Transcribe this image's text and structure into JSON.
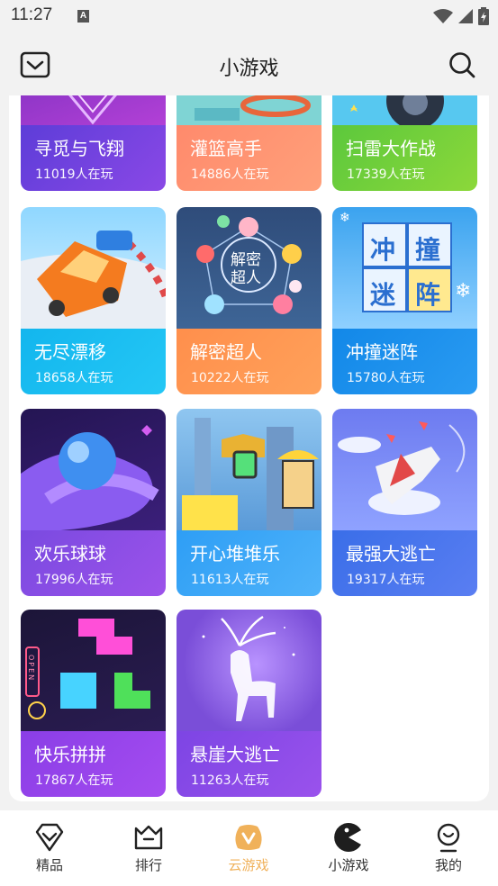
{
  "status_bar": {
    "time": "11:27",
    "notification_badge": "A"
  },
  "header": {
    "title": "小游戏"
  },
  "games": [
    {
      "name": "寻觅与飞翔",
      "players": "11019人在玩"
    },
    {
      "name": "灌篮高手",
      "players": "14886人在玩"
    },
    {
      "name": "扫雷大作战",
      "players": "17339人在玩"
    },
    {
      "name": "无尽漂移",
      "players": "18658人在玩"
    },
    {
      "name": "解密超人",
      "players": "10222人在玩",
      "art_text": [
        "解密",
        "超人"
      ]
    },
    {
      "name": "冲撞迷阵",
      "players": "15780人在玩",
      "art_text": [
        "冲",
        "撞",
        "迷",
        "阵"
      ]
    },
    {
      "name": "欢乐球球",
      "players": "17996人在玩"
    },
    {
      "name": "开心堆堆乐",
      "players": "11613人在玩"
    },
    {
      "name": "最强大逃亡",
      "players": "19317人在玩"
    },
    {
      "name": "快乐拼拼",
      "players": "17867人在玩",
      "art_text": "OPEN"
    },
    {
      "name": "悬崖大逃亡",
      "players": "11263人在玩"
    }
  ],
  "bottom_nav": [
    {
      "label": "精品",
      "icon": "diamond-icon"
    },
    {
      "label": "排行",
      "icon": "crown-icon"
    },
    {
      "label": "云游戏",
      "icon": "gamepad-icon",
      "active": true
    },
    {
      "label": "小游戏",
      "icon": "pacman-icon"
    },
    {
      "label": "我的",
      "icon": "profile-icon"
    }
  ],
  "colors": {
    "active_tab": "#f0b15a",
    "background": "#f2f2f2"
  }
}
